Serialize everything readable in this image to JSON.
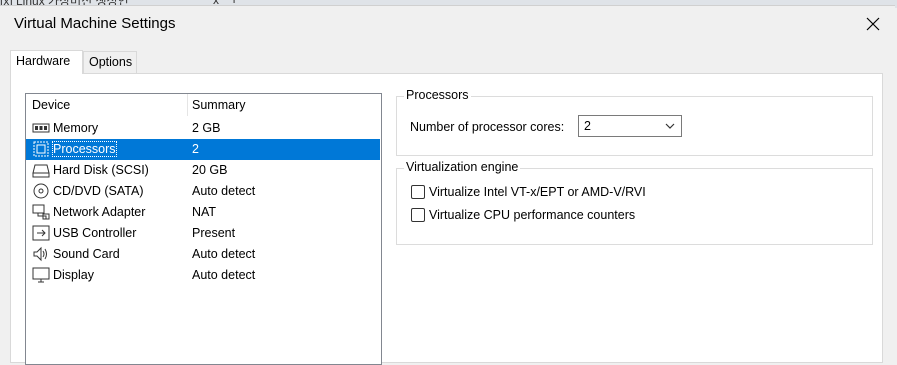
{
  "background": {
    "tab_title": "[x] Linux 가상머신 생성인",
    "tab_close": "x",
    "new_tab": "+"
  },
  "window": {
    "title": "Virtual Machine Settings",
    "close": "✕"
  },
  "tabs": [
    {
      "label": "Hardware",
      "active": true
    },
    {
      "label": "Options",
      "active": false
    }
  ],
  "device_list": {
    "columns": {
      "device": "Device",
      "summary": "Summary"
    },
    "rows": [
      {
        "icon": "memory-icon",
        "device": "Memory",
        "summary": "2 GB",
        "selected": false
      },
      {
        "icon": "processor-icon",
        "device": "Processors",
        "summary": "2",
        "selected": true
      },
      {
        "icon": "hard-disk-icon",
        "device": "Hard Disk (SCSI)",
        "summary": "20 GB",
        "selected": false
      },
      {
        "icon": "cd-dvd-icon",
        "device": "CD/DVD (SATA)",
        "summary": "Auto detect",
        "selected": false
      },
      {
        "icon": "network-adapter-icon",
        "device": "Network Adapter",
        "summary": "NAT",
        "selected": false
      },
      {
        "icon": "usb-icon",
        "device": "USB Controller",
        "summary": "Present",
        "selected": false
      },
      {
        "icon": "sound-card-icon",
        "device": "Sound Card",
        "summary": "Auto detect",
        "selected": false
      },
      {
        "icon": "display-icon",
        "device": "Display",
        "summary": "Auto detect",
        "selected": false
      }
    ]
  },
  "processors": {
    "group_title": "Processors",
    "cores_label": "Number of processor cores:",
    "cores_value": "2"
  },
  "virtualization": {
    "group_title": "Virtualization engine",
    "options": [
      {
        "label": "Virtualize Intel VT-x/EPT or AMD-V/RVI",
        "checked": false
      },
      {
        "label": "Virtualize CPU performance counters",
        "checked": false
      }
    ]
  },
  "colors": {
    "selection": "#0078d7",
    "window_bg": "#f0f0f0",
    "panel_bg": "#ffffff"
  }
}
